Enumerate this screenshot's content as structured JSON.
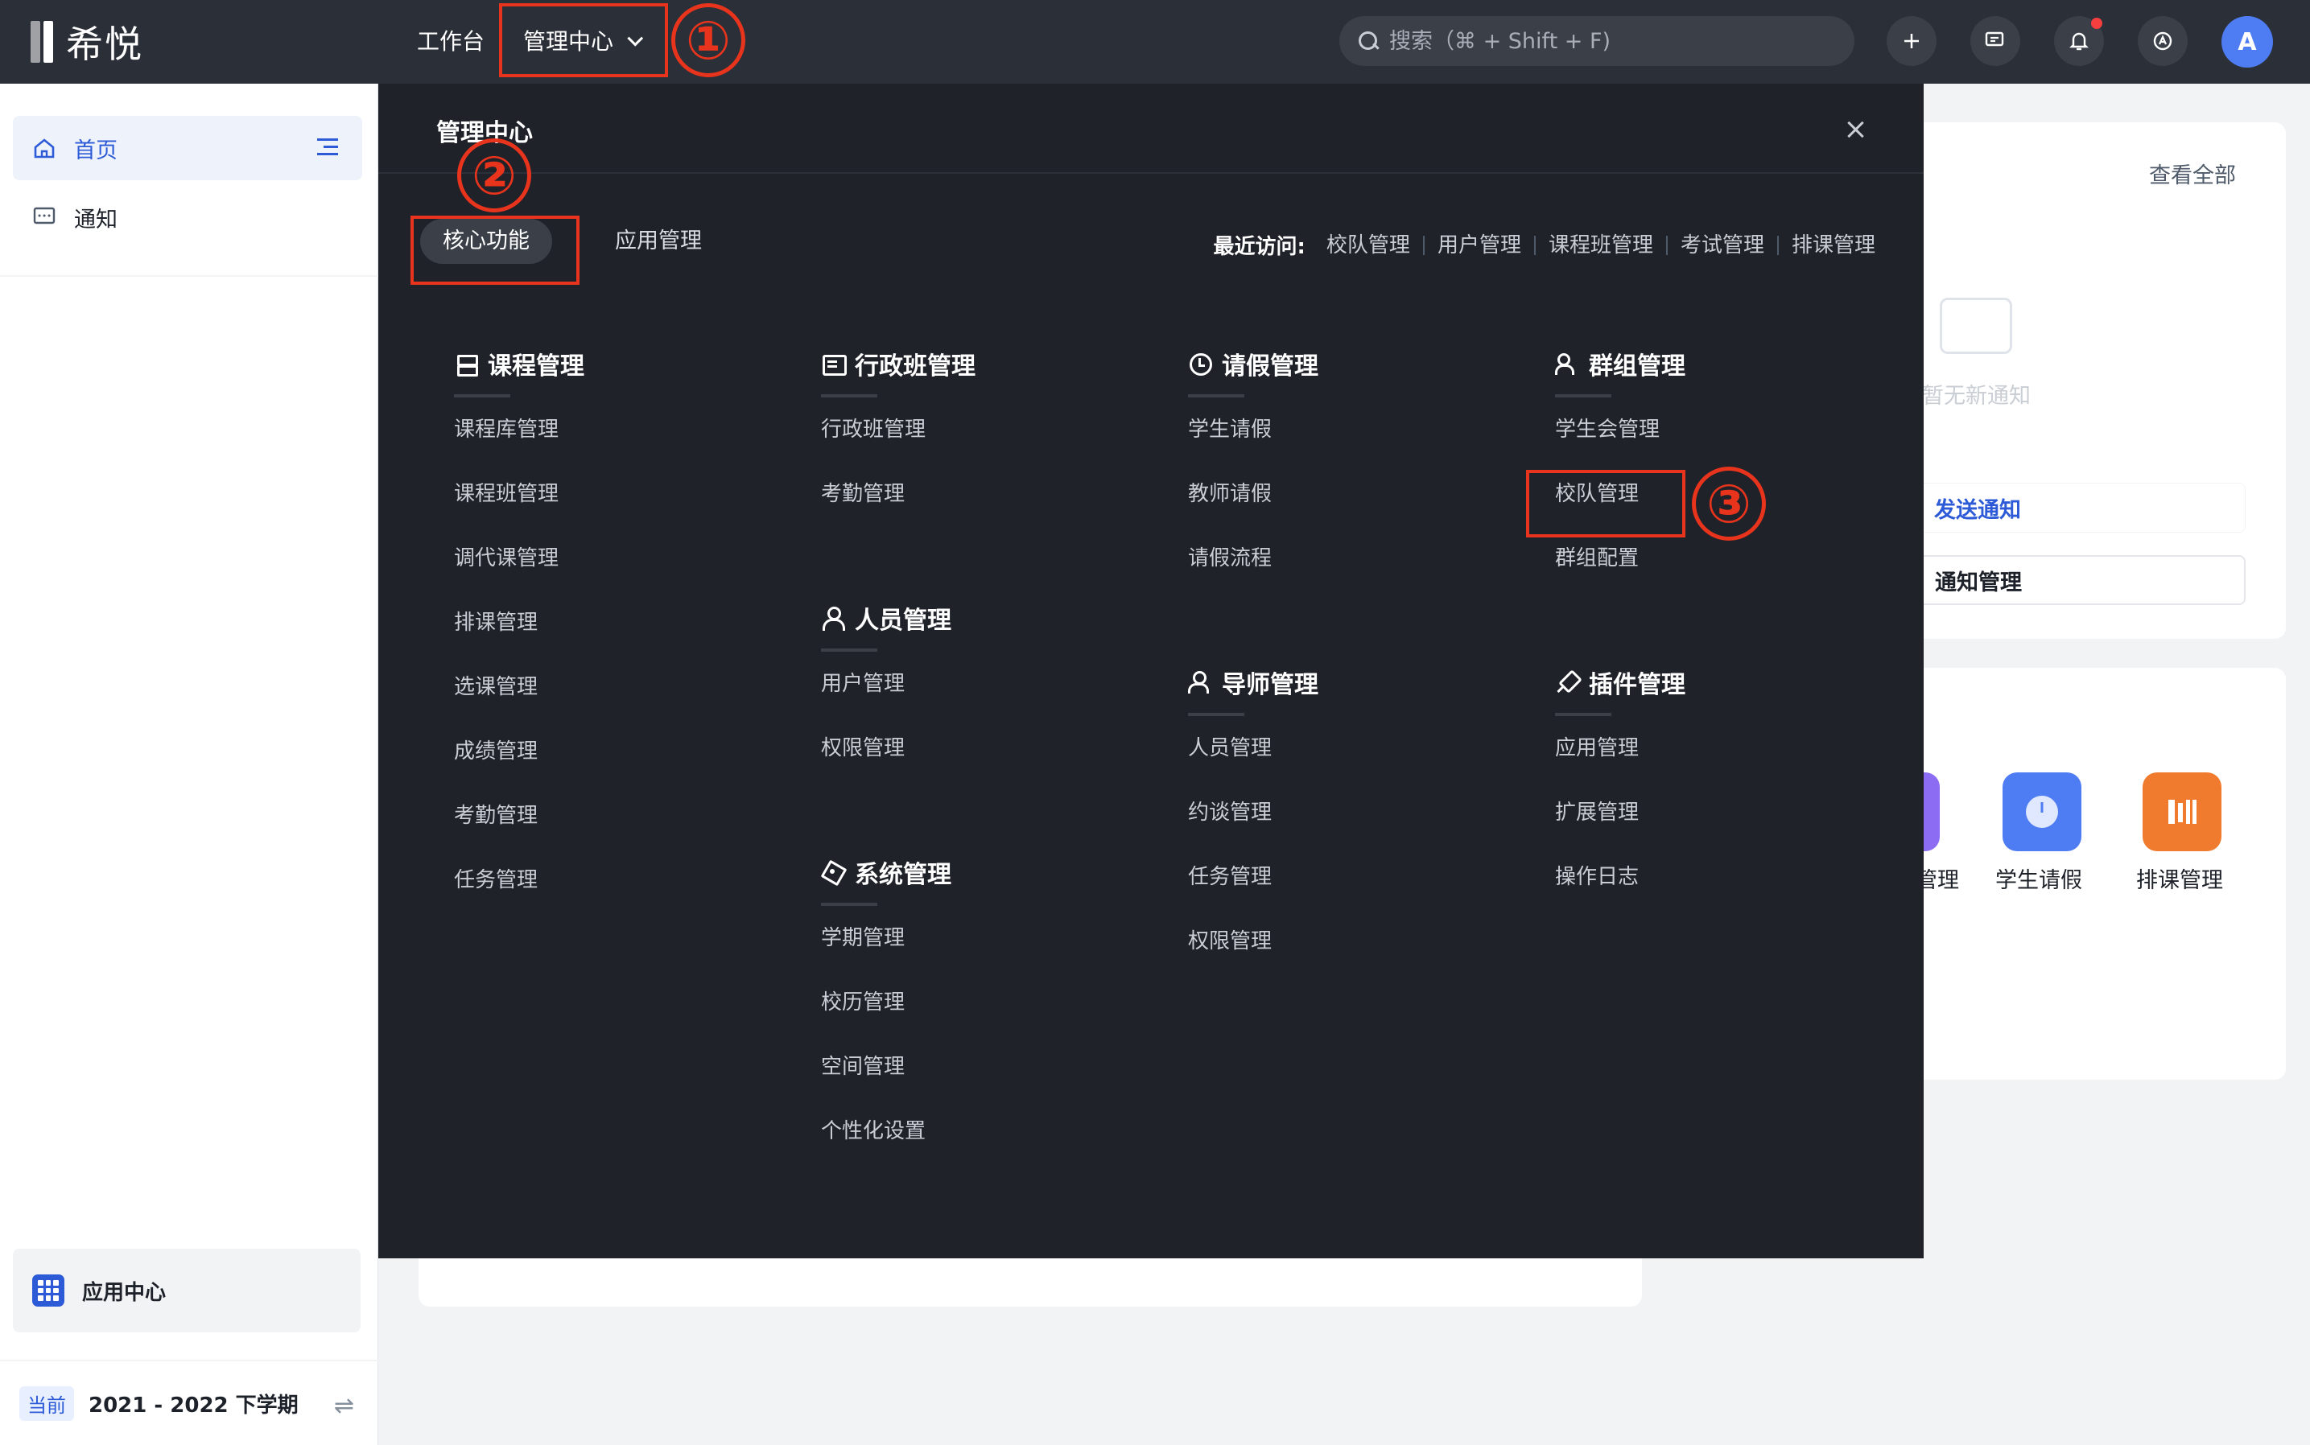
{
  "topbar": {
    "logo_text": "希悦",
    "nav_workbench": "工作台",
    "nav_management": "管理中心",
    "search_placeholder": "搜索（⌘ + Shift + F)",
    "avatar_letter": "A"
  },
  "sidebar": {
    "items": [
      {
        "label": "首页",
        "icon": "home-icon",
        "active": true
      },
      {
        "label": "通知",
        "icon": "message-icon",
        "active": false
      }
    ],
    "app_center_label": "应用中心",
    "term_badge": "当前",
    "term_label": "2021 - 2022 下学期"
  },
  "background": {
    "view_all": "查看全部",
    "empty_notice": "暂无新通知",
    "send_notice": "发送通知",
    "notice_management": "通知管理",
    "apps": [
      {
        "label": "管理",
        "color": "#8c6cf2"
      },
      {
        "label": "学生请假",
        "color": "#4e7cf3"
      },
      {
        "label": "排课管理",
        "color": "#f07a2e"
      }
    ]
  },
  "panel": {
    "title": "管理中心",
    "tabs": [
      {
        "label": "核心功能",
        "active": true
      },
      {
        "label": "应用管理",
        "active": false
      }
    ],
    "recent_label": "最近访问:",
    "recent_items": [
      "校队管理",
      "用户管理",
      "课程班管理",
      "考试管理",
      "排课管理"
    ],
    "groups": [
      {
        "title": "课程管理",
        "icon": "course-icon",
        "items": [
          "课程库管理",
          "课程班管理",
          "调代课管理",
          "排课管理",
          "选课管理",
          "成绩管理",
          "考勤管理",
          "任务管理"
        ]
      },
      {
        "title": "行政班管理",
        "icon": "class-icon",
        "items": [
          "行政班管理",
          "考勤管理"
        ]
      },
      {
        "title": "人员管理",
        "icon": "person-icon",
        "items": [
          "用户管理",
          "权限管理"
        ]
      },
      {
        "title": "系统管理",
        "icon": "system-icon",
        "items": [
          "学期管理",
          "校历管理",
          "空间管理",
          "个性化设置"
        ]
      },
      {
        "title": "请假管理",
        "icon": "clock-icon",
        "items": [
          "学生请假",
          "教师请假",
          "请假流程"
        ]
      },
      {
        "title": "导师管理",
        "icon": "mentor-icon",
        "items": [
          "人员管理",
          "约谈管理",
          "任务管理",
          "权限管理"
        ]
      },
      {
        "title": "群组管理",
        "icon": "group-icon",
        "items": [
          "学生会管理",
          "校队管理",
          "群组配置"
        ]
      },
      {
        "title": "插件管理",
        "icon": "plugin-icon",
        "items": [
          "应用管理",
          "扩展管理",
          "操作日志"
        ]
      }
    ]
  },
  "annotations": {
    "marker_1": "①",
    "marker_2": "②",
    "marker_3": "③",
    "color": "#e8341c"
  }
}
